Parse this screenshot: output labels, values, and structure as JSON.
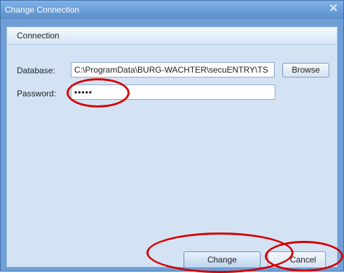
{
  "window": {
    "title": "Change Connection"
  },
  "group": {
    "title": "Connection"
  },
  "database": {
    "label": "Database:",
    "value": "C:\\ProgramData\\BURG-WACHTER\\secuENTRY\\TS",
    "browse_label": "Browse"
  },
  "password": {
    "label": "Password:",
    "value": "•••••"
  },
  "footer": {
    "change_label": "Change",
    "cancel_label": "Cancel"
  },
  "colors": {
    "titlebar": "#6f9fd6",
    "annotation": "#d40000"
  }
}
